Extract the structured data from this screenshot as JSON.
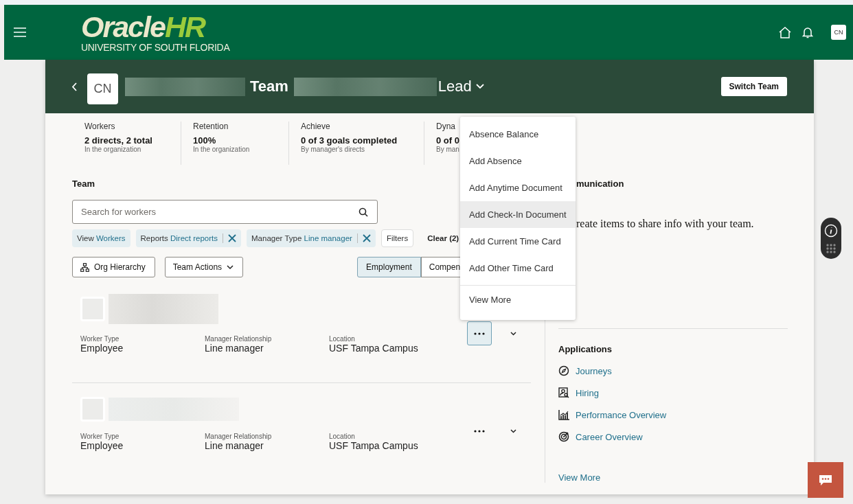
{
  "header": {
    "logo_main": "Oracle",
    "logo_accent": "HR",
    "logo_subtitle": "UNIVERSITY OF SOUTH FLORIDA",
    "avatar": "CN"
  },
  "team_header": {
    "avatar": "CN",
    "title": "Team",
    "role": "Lead",
    "button": "Switch Team"
  },
  "stats": [
    {
      "label": "Workers",
      "value": "2 directs, 2 total",
      "note": "In the organization"
    },
    {
      "label": "Retention",
      "value": "100%",
      "note": "In the organization"
    },
    {
      "label": "Achieve",
      "value": "0 of 3 goals completed",
      "note": "By manager's directs"
    },
    {
      "label": "Dyna",
      "value": "0 of 0",
      "note": "By man"
    }
  ],
  "team": {
    "heading": "Team",
    "search": {
      "placeholder": "Search for workers"
    },
    "chips": [
      {
        "label": "View",
        "value": "Workers",
        "removable": false
      },
      {
        "label": "Reports",
        "value": "Direct reports",
        "removable": true
      },
      {
        "label": "Manager Type",
        "value": "Line manager",
        "removable": true
      }
    ],
    "filters_button": "Filters",
    "clear": "Clear (2)",
    "org_button": "Org Hierarchy",
    "actions_button": "Team Actions",
    "view_tabs": [
      {
        "label": "Employment",
        "selected": true
      },
      {
        "label": "Compen",
        "selected": false
      }
    ],
    "workers": [
      {
        "active": true,
        "fields": [
          {
            "label": "Worker Type",
            "value": "Employee"
          },
          {
            "label": "Manager Relationship",
            "value": "Line manager"
          },
          {
            "label": "Location",
            "value": "USF Tampa Campus"
          }
        ]
      },
      {
        "active": false,
        "fields": [
          {
            "label": "Worker Type",
            "value": "Employee"
          },
          {
            "label": "Manager Relationship",
            "value": "Line manager"
          },
          {
            "label": "Location",
            "value": "USF Tampa Campus"
          }
        ]
      }
    ]
  },
  "action_menu": {
    "items": [
      {
        "label": "Absence Balance",
        "highlighted": false
      },
      {
        "label": "Add Absence",
        "highlighted": false
      },
      {
        "label": "Add Anytime Document",
        "highlighted": false
      },
      {
        "label": "Add Check-In Document",
        "highlighted": true
      },
      {
        "label": "Add Current Time Card",
        "highlighted": false
      },
      {
        "label": "Add Other Time Card",
        "highlighted": false
      }
    ],
    "view_more": "View More"
  },
  "communication": {
    "heading": "munication",
    "text": "reate items to share info with your team."
  },
  "applications": {
    "heading": "Applications",
    "links": [
      {
        "kind": "compass",
        "label": "Journeys"
      },
      {
        "kind": "person-search",
        "label": "Hiring"
      },
      {
        "kind": "chart",
        "label": "Performance Overview"
      },
      {
        "kind": "target",
        "label": "Career Overview"
      }
    ],
    "view_more": "View More"
  }
}
